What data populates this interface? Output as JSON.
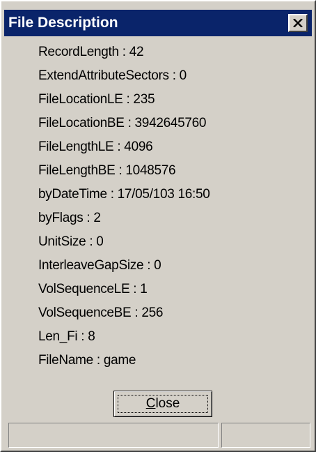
{
  "window": {
    "title": "File Description",
    "close_icon": "close-x-icon"
  },
  "fields": [
    "RecordLength : 42",
    "ExtendAttributeSectors : 0",
    "FileLocationLE : 235",
    "FileLocationBE : 3942645760",
    "FileLengthLE : 4096",
    "FileLengthBE : 1048576",
    "byDateTime : 17/05/103 16:50",
    "byFlags : 2",
    "UnitSize : 0",
    "InterleaveGapSize : 0",
    "VolSequenceLE : 1",
    "VolSequenceBE : 256",
    "Len_Fi : 8",
    "FileName : game"
  ],
  "button": {
    "close_label": "Close"
  },
  "statusbar": {
    "pane1": "",
    "pane2": ""
  },
  "colors": {
    "titlebar": "#0a246a",
    "face": "#d4d0c8",
    "title_text": "#ffffff"
  }
}
